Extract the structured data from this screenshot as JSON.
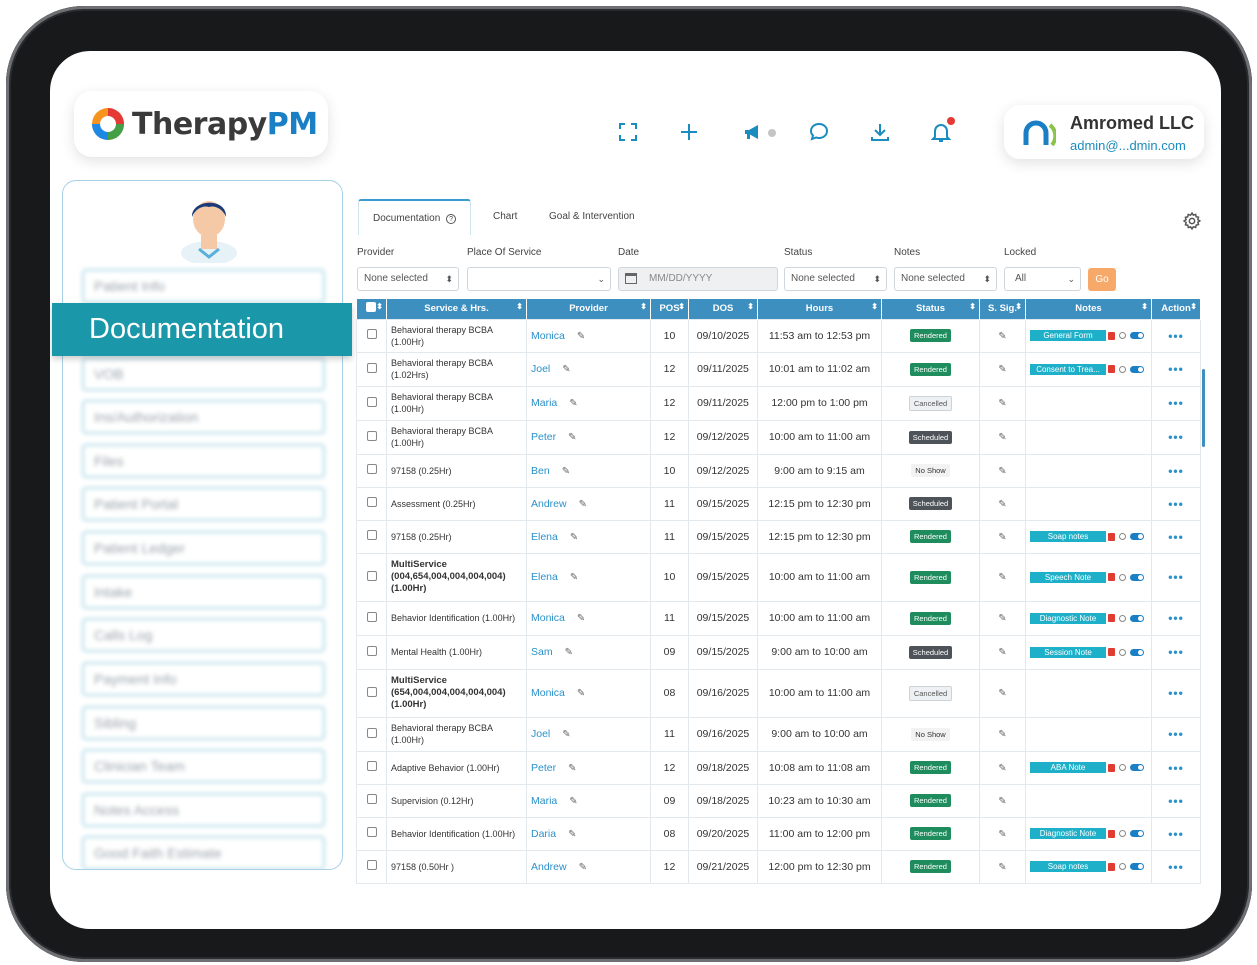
{
  "brand": {
    "name_part1": "Therapy",
    "name_part2": "PM"
  },
  "top_icons": [
    "fullscreen-icon",
    "plus-icon",
    "megaphone-icon",
    "chat-icon",
    "download-icon",
    "bell-icon"
  ],
  "user": {
    "name": "Amromed LLC",
    "email": "admin@...dmin.com"
  },
  "sidebar": {
    "banner": "Documentation",
    "items": [
      "Patient Info",
      "VOB",
      "Ins/Authorization",
      "Files",
      "Patient Portal",
      "Patient Ledger",
      "Intake",
      "Calls Log",
      "Payment Info",
      "Sibling",
      "Clinician Team",
      "Notes Access",
      "Good Faith Estimate"
    ]
  },
  "tabs": {
    "documentation": "Documentation",
    "chart": "Chart",
    "goal": "Goal & Intervention"
  },
  "filters": {
    "labels": {
      "provider": "Provider",
      "place": "Place Of Service",
      "date": "Date",
      "status": "Status",
      "notes": "Notes",
      "locked": "Locked"
    },
    "provider_value": "None selected",
    "place_value": "",
    "date_placeholder": "MM/DD/YYYY",
    "status_value": "None selected",
    "notes_value": "None selected",
    "locked_value": "All",
    "go_label": "Go"
  },
  "table": {
    "headers": {
      "service": "Service & Hrs.",
      "provider": "Provider",
      "pos": "POS",
      "dos": "DOS",
      "hours": "Hours",
      "status": "Status",
      "sig": "S. Sig.",
      "notes": "Notes",
      "action": "Action"
    },
    "rows": [
      {
        "service": "Behavioral therapy BCBA (1.00Hr)",
        "bold": false,
        "provider": "Monica",
        "pos": "10",
        "dos": "09/10/2025",
        "hours": "11:53 am to 12:53 pm",
        "status": "Rendered",
        "note": "General Form"
      },
      {
        "service": "Behavioral therapy BCBA (1.02Hrs)",
        "bold": false,
        "provider": "Joel",
        "pos": "12",
        "dos": "09/11/2025",
        "hours": "10:01 am to 11:02 am",
        "status": "Rendered",
        "note": "Consent to Trea..."
      },
      {
        "service": "Behavioral therapy BCBA (1.00Hr)",
        "bold": false,
        "provider": "Maria",
        "pos": "12",
        "dos": "09/11/2025",
        "hours": "12:00 pm to 1:00 pm",
        "status": "Cancelled",
        "note": ""
      },
      {
        "service": "Behavioral therapy BCBA (1.00Hr)",
        "bold": false,
        "provider": "Peter",
        "pos": "12",
        "dos": "09/12/2025",
        "hours": "10:00 am to 11:00 am",
        "status": "Scheduled",
        "note": ""
      },
      {
        "service": "97158 (0.25Hr)",
        "bold": false,
        "provider": "Ben",
        "pos": "10",
        "dos": "09/12/2025",
        "hours": "9:00 am to 9:15 am",
        "status": "No Show",
        "note": ""
      },
      {
        "service": "Assessment (0.25Hr)",
        "bold": false,
        "provider": "Andrew",
        "pos": "11",
        "dos": "09/15/2025",
        "hours": "12:15 pm to 12:30 pm",
        "status": "Scheduled",
        "note": ""
      },
      {
        "service": "97158 (0.25Hr)",
        "bold": false,
        "provider": "Elena",
        "pos": "11",
        "dos": "09/15/2025",
        "hours": "12:15 pm to 12:30 pm",
        "status": "Rendered",
        "note": "Soap notes"
      },
      {
        "service": "MultiService (004,654,004,004,004,004) (1.00Hr)",
        "bold": true,
        "provider": "Elena",
        "pos": "10",
        "dos": "09/15/2025",
        "hours": "10:00 am to 11:00 am",
        "status": "Rendered",
        "note": "Speech Note"
      },
      {
        "service": "Behavior Identification (1.00Hr)",
        "bold": false,
        "provider": "Monica",
        "pos": "11",
        "dos": "09/15/2025",
        "hours": "10:00 am to 11:00 am",
        "status": "Rendered",
        "note": "Diagnostic Note"
      },
      {
        "service": "Mental Health (1.00Hr)",
        "bold": false,
        "provider": "Sam",
        "pos": "09",
        "dos": "09/15/2025",
        "hours": "9:00 am to 10:00 am",
        "status": "Scheduled",
        "note": "Session Note"
      },
      {
        "service": "MultiService (654,004,004,004,004,004) (1.00Hr)",
        "bold": true,
        "provider": "Monica",
        "pos": "08",
        "dos": "09/16/2025",
        "hours": "10:00 am to 11:00 am",
        "status": "Cancelled",
        "note": ""
      },
      {
        "service": "Behavioral therapy BCBA (1.00Hr)",
        "bold": false,
        "provider": "Joel",
        "pos": "11",
        "dos": "09/16/2025",
        "hours": "9:00 am to 10:00 am",
        "status": "No Show",
        "note": ""
      },
      {
        "service": "Adaptive Behavior (1.00Hr)",
        "bold": false,
        "provider": "Peter",
        "pos": "12",
        "dos": "09/18/2025",
        "hours": "10:08 am to 11:08 am",
        "status": "Rendered",
        "note": "ABA Note"
      },
      {
        "service": "Supervision (0.12Hr)",
        "bold": false,
        "provider": "Maria",
        "pos": "09",
        "dos": "09/18/2025",
        "hours": "10:23 am to 10:30 am",
        "status": "Rendered",
        "note": ""
      },
      {
        "service": "Behavior Identification (1.00Hr)",
        "bold": false,
        "provider": "Daria",
        "pos": "08",
        "dos": "09/20/2025",
        "hours": "11:00 am to 12:00 pm",
        "status": "Rendered",
        "note": "Diagnostic Note"
      },
      {
        "service": "97158 (0.50Hr )",
        "bold": false,
        "provider": "Andrew",
        "pos": "12",
        "dos": "09/21/2025",
        "hours": "12:00 pm to 12:30 pm",
        "status": "Rendered",
        "note": "Soap notes"
      }
    ]
  },
  "colors": {
    "primary": "#3d8fc0",
    "teal": "#1a97a8",
    "rendered": "#1e8c5c",
    "scheduled": "#4d5358",
    "go": "#f7a96a"
  }
}
